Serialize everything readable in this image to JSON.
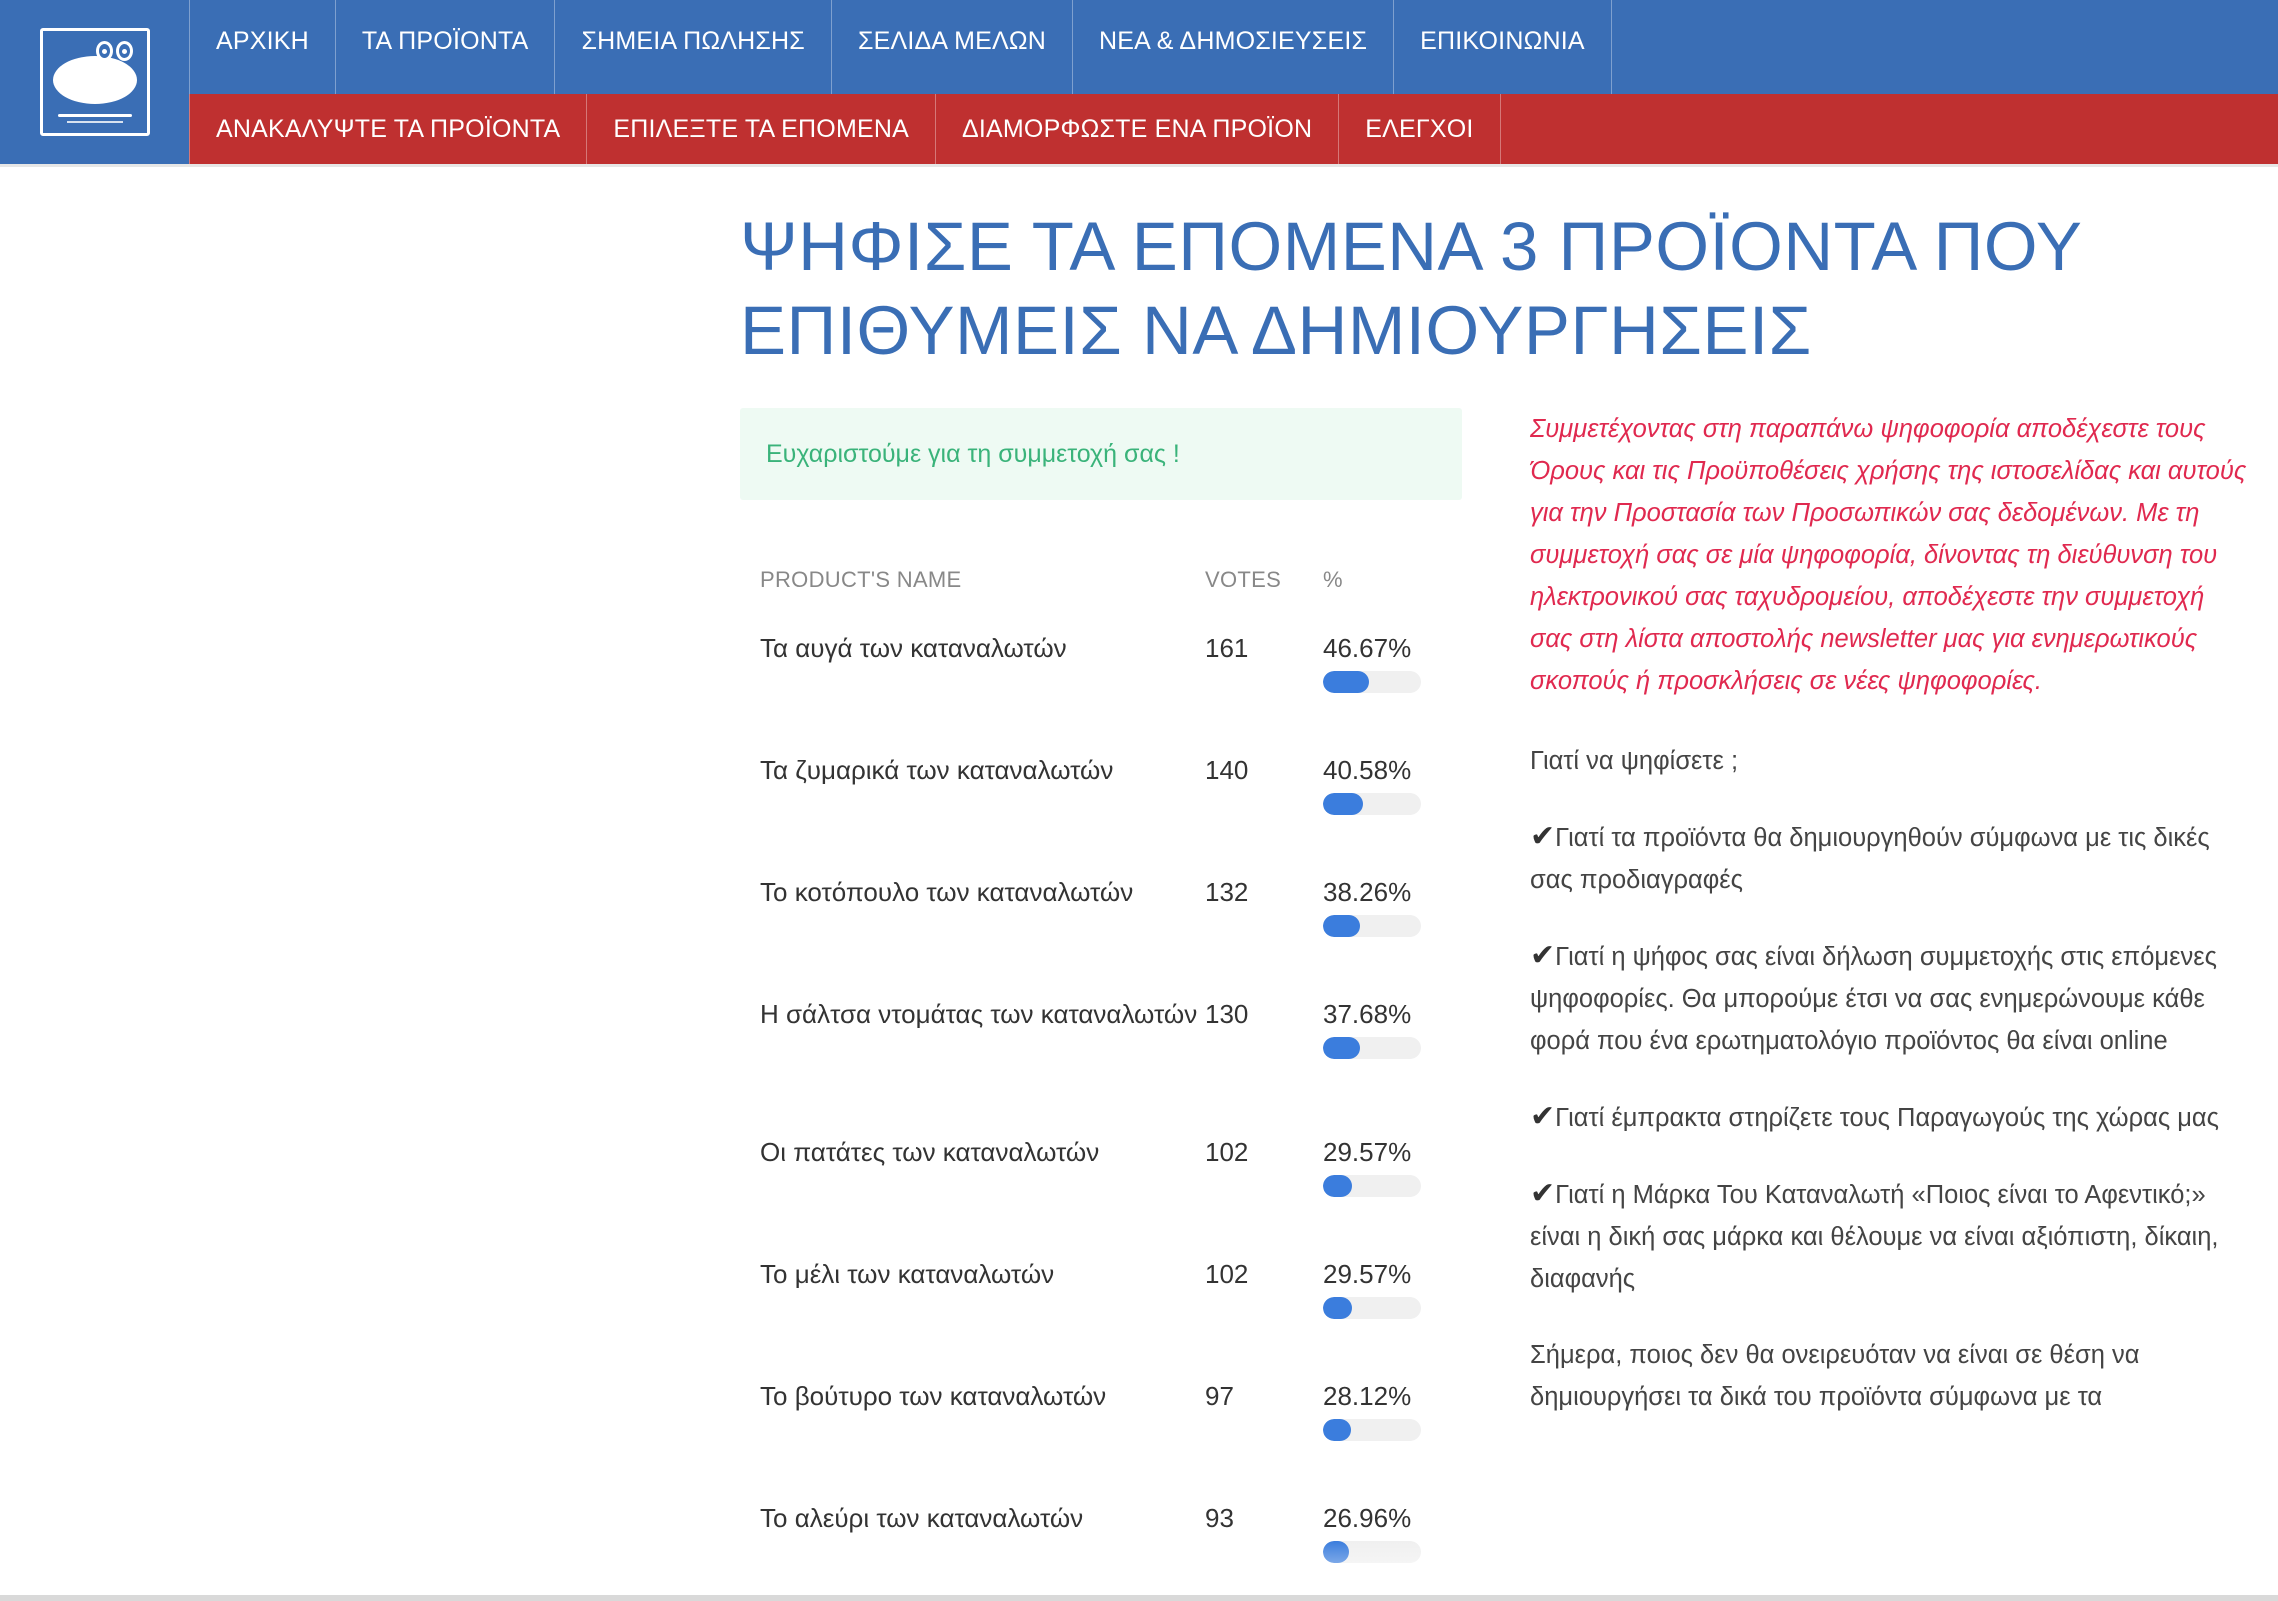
{
  "nav": {
    "top": [
      "ΑΡΧΙΚΗ",
      "ΤΑ ΠΡΟΪΟΝΤΑ",
      "ΣΗΜΕΙΑ ΠΩΛΗΣΗΣ",
      "ΣΕΛΙΔΑ ΜΕΛΩΝ",
      "ΝΕΑ & ΔΗΜΟΣΙΕΥΣΕΙΣ",
      "ΕΠΙΚΟΙΝΩΝΙΑ"
    ],
    "bottom": [
      "ΑΝΑΚΑΛΥΨΤΕ ΤΑ ΠΡΟΪΟΝΤΑ",
      "ΕΠΙΛΕΞΤΕ ΤΑ ΕΠΟΜΕΝΑ",
      "ΔΙΑΜΟΡΦΩΣΤΕ ΕΝΑ ΠΡΟΪΟΝ",
      "ΕΛΕΓΧΟΙ"
    ]
  },
  "logo": {
    "icon": "brand-logo-icon"
  },
  "page": {
    "title_line1": "ΨΗΦΙΣΕ ΤΑ ΕΠΟΜΕΝΑ 3 ΠΡΟΪΟΝΤΑ ΠΟΥ",
    "title_line2": "ΕΠΙΘΥΜΕΙΣ ΝΑ ΔΗΜΙΟΥΡΓΗΣΕΙΣ",
    "thanks": "Ευχαριστούμε για τη συμμετοχή σας !"
  },
  "results": {
    "headers": {
      "name": "PRODUCT'S NAME",
      "votes": "VOTES",
      "pct": "%"
    },
    "rows": [
      {
        "name": "Τα αυγά των καταναλωτών",
        "votes": "161",
        "pct": "46.67%",
        "fill": 46.67
      },
      {
        "name": "Τα ζυμαρικά των καταναλωτών",
        "votes": "140",
        "pct": "40.58%",
        "fill": 40.58
      },
      {
        "name": "Το κοτόπουλο των καταναλωτών",
        "votes": "132",
        "pct": "38.26%",
        "fill": 38.26
      },
      {
        "name": "Η σάλτσα ντομάτας των καταναλωτών",
        "votes": "130",
        "pct": "37.68%",
        "fill": 37.68
      },
      {
        "name": "Οι πατάτες των καταναλωτών",
        "votes": "102",
        "pct": "29.57%",
        "fill": 29.57
      },
      {
        "name": "Το μέλι των καταναλωτών",
        "votes": "102",
        "pct": "29.57%",
        "fill": 29.57
      },
      {
        "name": "Το βούτυρο των καταναλωτών",
        "votes": "97",
        "pct": "28.12%",
        "fill": 28.12
      },
      {
        "name": "Το αλεύρι των καταναλωτών",
        "votes": "93",
        "pct": "26.96%",
        "fill": 26.96
      }
    ],
    "bar_color": "#3b7ddd"
  },
  "side": {
    "terms": "Συμμετέχοντας στη παραπάνω ψηφοφορία αποδέχεστε τους Όρους και τις Προϋποθέσεις χρήσης της ιστοσελίδας και αυτούς για την Προστασία των Προσωπικών σας δεδομένων. Με τη συμμετοχή σας σε μία ψηφοφορία, δίνοντας τη διεύθυνση του ηλεκτρονικού σας ταχυδρομείου, αποδέχεστε την συμμετοχή σας στη λίστα αποστολής newsletter μας για ενημερωτικούς σκοπούς ή προσκλήσεις σε νέες ψηφοφορίες.",
    "why_title": "Γιατί να ψηφίσετε ;",
    "check_icon": "✔",
    "reasons": [
      "Γιατί τα προϊόντα θα δημιουργηθούν σύμφωνα με τις δικές σας προδιαγραφές",
      "Γιατί η ψήφος σας είναι δήλωση συμμετοχής στις επόμενες ψηφοφορίες. Θα μπορούμε έτσι να σας ενημερώνουμε κάθε φορά που ένα ερωτηματολόγιο προϊόντος θα είναι online",
      "Γιατί έμπρακτα στηρίζετε τους Παραγωγούς της χώρας μας",
      "Γιατί η Μάρκα Του Καταναλωτή «Ποιος είναι το Αφεντικό;» είναι η δική σας μάρκα και θέλουμε να είναι αξιόπιστη, δίκαιη, διαφανής"
    ],
    "closing": "Σήμερα, ποιος δεν θα ονειρευόταν να είναι σε θέση να δημιουργήσει τα δικά του προϊόντα σύμφωνα με τα"
  },
  "colors": {
    "nav_blue": "#3a6eb5",
    "nav_red": "#bf3030",
    "title_blue": "#3a6eb5",
    "success_green": "#3ab37a",
    "terms_red": "#e0294f"
  }
}
